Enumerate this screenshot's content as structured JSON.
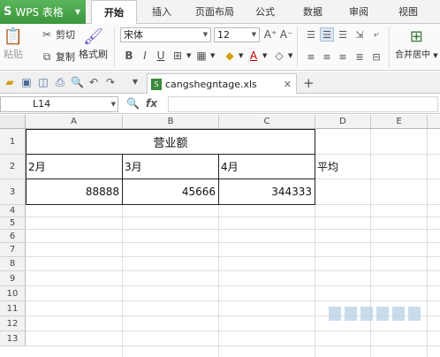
{
  "app": {
    "name": "WPS 表格",
    "logo": "S",
    "tabs": [
      {
        "label": "开始",
        "active": true
      },
      {
        "label": "插入",
        "active": false
      },
      {
        "label": "页面布局",
        "active": false
      },
      {
        "label": "公式",
        "active": false
      },
      {
        "label": "数据",
        "active": false
      },
      {
        "label": "审阅",
        "active": false
      },
      {
        "label": "视图",
        "active": false
      }
    ]
  },
  "ribbon": {
    "paste_label": "粘贴",
    "cut_label": "剪切",
    "copy_label": "复制",
    "format_painter_label": "格式刷",
    "font_name": "宋体",
    "font_size": "12",
    "bold": "B",
    "italic": "I",
    "underline": "U",
    "merge_center_label": "合并居中"
  },
  "quick_access": {
    "document_tab": "cangshegntage.xls"
  },
  "formula_bar": {
    "name_box": "L14",
    "fx_label": "fx"
  },
  "sheet": {
    "columns": [
      "A",
      "B",
      "C",
      "D",
      "E"
    ],
    "rows": [
      "1",
      "2",
      "3",
      "4",
      "5",
      "6",
      "7",
      "8",
      "9",
      "10",
      "11",
      "12",
      "13"
    ],
    "cells": {
      "title": "营业额",
      "a2": "2月",
      "b2": "3月",
      "c2": "4月",
      "d2": "平均",
      "a3": "88888",
      "b3": "45666",
      "c3": "344333"
    }
  }
}
